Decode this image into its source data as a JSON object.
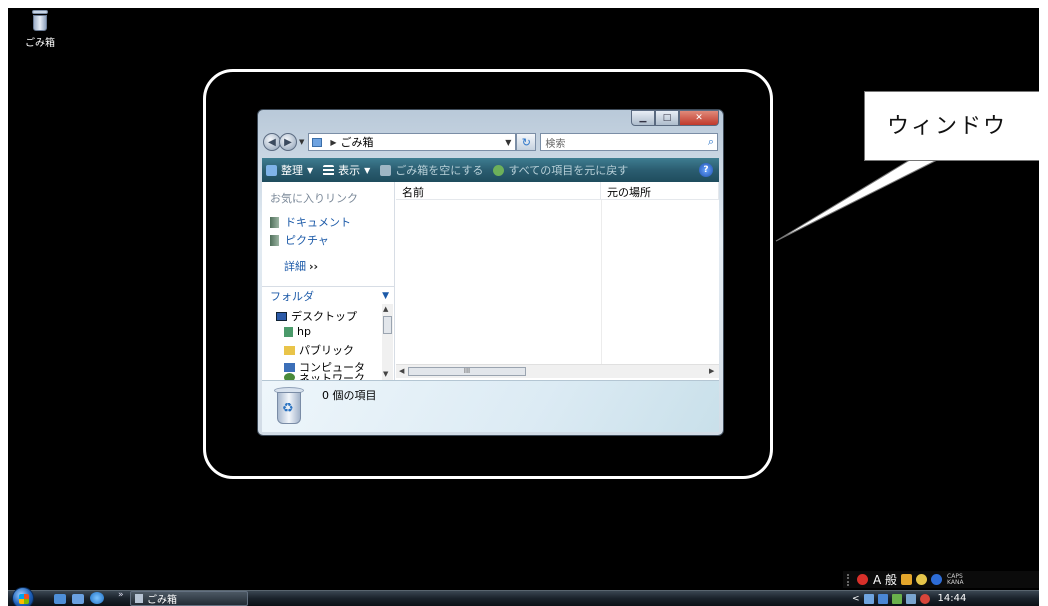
{
  "desktop": {
    "icon_label": "ごみ箱"
  },
  "callout": {
    "text": "ウィンドウ"
  },
  "window": {
    "address": {
      "crumb": "ごみ箱"
    },
    "search": {
      "placeholder": "検索"
    },
    "toolbar": {
      "organize": "整理",
      "view": "表示",
      "empty_bin": "ごみ箱を空にする",
      "restore_all": "すべての項目を元に戻す"
    },
    "nav": {
      "favorites_title": "お気に入りリンク",
      "favorites": [
        "ドキュメント",
        "ピクチャ"
      ],
      "more": "詳細",
      "folders_title": "フォルダ",
      "tree": [
        "デスクトップ",
        "hp",
        "パブリック",
        "コンピュータ",
        "ネットワーク"
      ]
    },
    "columns": [
      "名前",
      "元の場所"
    ],
    "details": {
      "count": "0 個の項目"
    }
  },
  "taskbar": {
    "task_label": "ごみ箱",
    "ime_mode": "A 般",
    "caps": "CAPS",
    "kana": "KANA",
    "time": "14:44"
  },
  "colors": {
    "desktop": "#000000",
    "toolbar": "#2b5d70",
    "link": "#1c5aa8"
  }
}
